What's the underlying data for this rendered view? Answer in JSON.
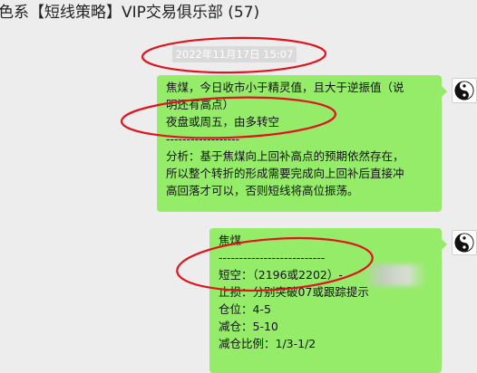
{
  "chat": {
    "title": "色系【短线策略】VIP交易俱乐部 (57)",
    "timestamp": "2022年11月17日 15:07"
  },
  "messages": [
    {
      "lines": [
        "焦煤，今日收市小于精灵值，且大于逆振值（说",
        "明还有高点）",
        "夜盘或周五，由多转空",
        "------------------",
        "分析：基于焦煤向上回补高点的预期依然存在，",
        "所以整个转折的形成需要完成向上回补后直接冲",
        "高回落才可以，否则短线将高位振荡。"
      ]
    },
    {
      "lines": [
        "焦煤",
        "--------------------------",
        "短空：（2196或2202）-",
        "止损：分别突破07或跟踪提示",
        "仓位：4-5",
        "减仓：5-10",
        "减仓比例：1/3-1/2"
      ]
    }
  ],
  "colors": {
    "bubble": "#95ec69",
    "annotation": "#e0141e",
    "background": "#ededed"
  },
  "icons": [
    "yin-yang-icon"
  ]
}
